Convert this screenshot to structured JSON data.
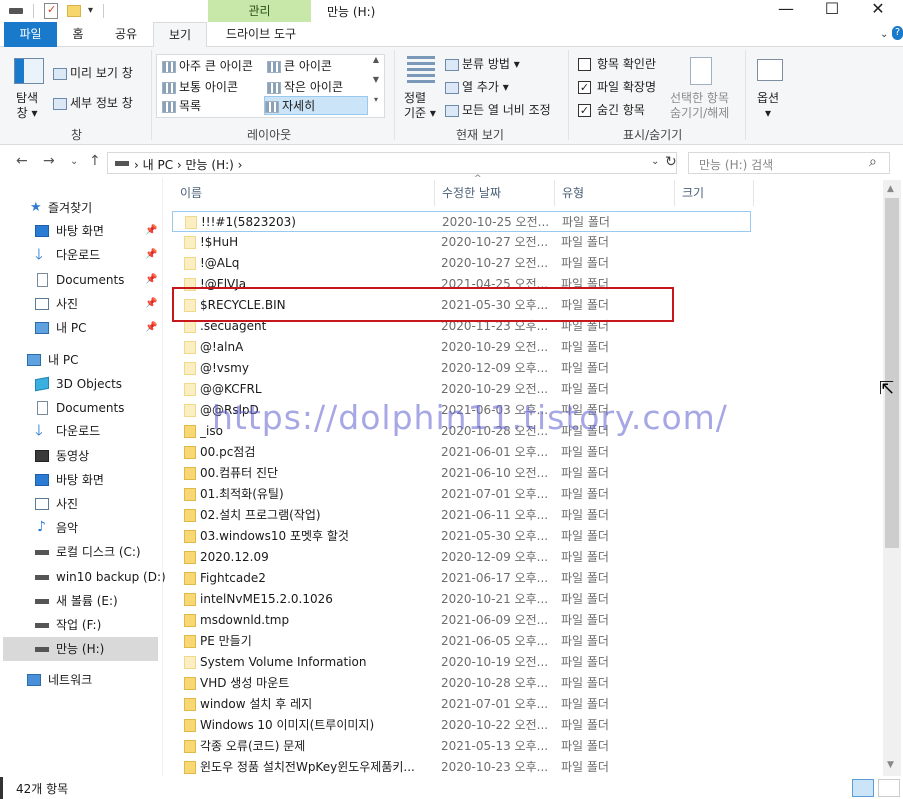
{
  "titlebar": {
    "manage_tab": "관리",
    "window_title": "만능 (H:)",
    "minimize": "—",
    "maximize": "☐",
    "close": "✕"
  },
  "tabs": {
    "file": "파일",
    "home": "홈",
    "share": "공유",
    "view": "보기",
    "drive_tools": "드라이브 도구"
  },
  "ribbon": {
    "pane": {
      "nav_pane": "탐색\n창 ▾",
      "preview_pane": "미리 보기 창",
      "details_pane": "세부 정보 창",
      "group_label": "창"
    },
    "layout": {
      "extra_large": "아주 큰 아이콘",
      "large": "큰 아이콘",
      "medium": "보통 아이콘",
      "small": "작은 아이콘",
      "list": "목록",
      "details": "자세히",
      "group_label": "레이아웃"
    },
    "current_view": {
      "sort_by": "정렬\n기준 ▾",
      "group_by": "분류 방법 ▾",
      "add_columns": "열 추가 ▾",
      "size_columns": "모든 열 너비 조정",
      "group_label": "현재 보기"
    },
    "show_hide": {
      "item_checkboxes": "항목 확인란",
      "file_extensions": "파일 확장명",
      "hidden_items": "숨긴 항목",
      "hide_selected": "선택한 항목\n숨기기/해제",
      "group_label": "표시/숨기기"
    },
    "options": "옵션\n▾"
  },
  "address": {
    "crumb": "›  내 PC  ›  만능 (H:)  ›",
    "search_placeholder": "만능 (H:) 검색"
  },
  "nav": {
    "items": [
      {
        "label": "즐겨찾기",
        "icon": "star-icon"
      },
      {
        "label": "바탕 화면",
        "icon": "desktop-icon"
      },
      {
        "label": "다운로드",
        "icon": "download-icon"
      },
      {
        "label": "Documents",
        "icon": "documents-icon"
      },
      {
        "label": "사진",
        "icon": "pictures-icon"
      },
      {
        "label": "내 PC",
        "icon": "pc-icon"
      },
      {
        "label": "내 PC",
        "icon": "pc-icon"
      },
      {
        "label": "3D Objects",
        "icon": "3d-objects-icon"
      },
      {
        "label": "Documents",
        "icon": "documents-icon"
      },
      {
        "label": "다운로드",
        "icon": "download-icon"
      },
      {
        "label": "동영상",
        "icon": "video-icon"
      },
      {
        "label": "바탕 화면",
        "icon": "desktop-icon"
      },
      {
        "label": "사진",
        "icon": "pictures-icon"
      },
      {
        "label": "음악",
        "icon": "music-icon"
      },
      {
        "label": "로컬 디스크 (C:)",
        "icon": "local-disk-icon"
      },
      {
        "label": "win10 backup (D:)",
        "icon": "drive-icon"
      },
      {
        "label": "새 볼륨 (E:)",
        "icon": "drive-icon"
      },
      {
        "label": "작업 (F:)",
        "icon": "drive-icon"
      },
      {
        "label": "만능 (H:)",
        "icon": "drive-icon"
      },
      {
        "label": "네트워크",
        "icon": "network-icon"
      }
    ]
  },
  "columns": {
    "name": "이름",
    "modified": "수정한 날짜",
    "type": "유형",
    "size": "크기"
  },
  "files": [
    {
      "name": "!!!#1(5823203)",
      "date": "2020-10-25 오전...",
      "type": "파일 폴더"
    },
    {
      "name": "!$HuH",
      "date": "2020-10-27 오전...",
      "type": "파일 폴더"
    },
    {
      "name": "!@ALq",
      "date": "2020-10-27 오전...",
      "type": "파일 폴더"
    },
    {
      "name": "!@FlVJa",
      "date": "2021-04-25 오전...",
      "type": "파일 폴더"
    },
    {
      "name": "$RECYCLE.BIN",
      "date": "2021-05-30 오후...",
      "type": "파일 폴더"
    },
    {
      "name": ".secuagent",
      "date": "2020-11-23 오후...",
      "type": "파일 폴더"
    },
    {
      "name": "@!alnA",
      "date": "2020-10-29 오전...",
      "type": "파일 폴더"
    },
    {
      "name": "@!vsmy",
      "date": "2020-12-09 오후...",
      "type": "파일 폴더"
    },
    {
      "name": "@@KCFRL",
      "date": "2020-10-29 오전...",
      "type": "파일 폴더"
    },
    {
      "name": "@@RslpD",
      "date": "2021-06-03 오후...",
      "type": "파일 폴더"
    },
    {
      "name": "_iso",
      "date": "2020-10-28 오전...",
      "type": "파일 폴더"
    },
    {
      "name": "00.pc점검",
      "date": "2021-06-01 오후...",
      "type": "파일 폴더"
    },
    {
      "name": "00.컴퓨터 진단",
      "date": "2021-06-10 오전...",
      "type": "파일 폴더"
    },
    {
      "name": "01.최적화(유틸)",
      "date": "2021-07-01 오후...",
      "type": "파일 폴더"
    },
    {
      "name": "02.설치 프로그램(작업)",
      "date": "2021-06-11 오후...",
      "type": "파일 폴더"
    },
    {
      "name": "03.windows10 포멧후 할것",
      "date": "2021-05-30 오후...",
      "type": "파일 폴더"
    },
    {
      "name": "2020.12.09",
      "date": "2020-12-09 오후...",
      "type": "파일 폴더"
    },
    {
      "name": "Fightcade2",
      "date": "2021-06-17 오후...",
      "type": "파일 폴더"
    },
    {
      "name": "intelNvME15.2.0.1026",
      "date": "2020-10-21 오후...",
      "type": "파일 폴더"
    },
    {
      "name": "msdownld.tmp",
      "date": "2021-06-09 오전...",
      "type": "파일 폴더"
    },
    {
      "name": "PE 만들기",
      "date": "2021-06-05 오후...",
      "type": "파일 폴더"
    },
    {
      "name": "System Volume Information",
      "date": "2020-10-19 오전...",
      "type": "파일 폴더"
    },
    {
      "name": "VHD 생성 마운트",
      "date": "2020-10-28 오후...",
      "type": "파일 폴더"
    },
    {
      "name": "window 설치 후 레지",
      "date": "2021-07-01 오후...",
      "type": "파일 폴더"
    },
    {
      "name": "Windows 10 이미지(트루이미지)",
      "date": "2020-10-22 오전...",
      "type": "파일 폴더"
    },
    {
      "name": "각종  오류(코드) 문제",
      "date": "2021-05-13 오후...",
      "type": "파일 폴더"
    },
    {
      "name": "윈도우 정품 설치전WpKey윈도우제품키...",
      "date": "2020-10-23 오후...",
      "type": "파일 폴더"
    }
  ],
  "watermark": "https://dolphin11.tistory.com/",
  "status": {
    "item_count": "42개 항목"
  }
}
